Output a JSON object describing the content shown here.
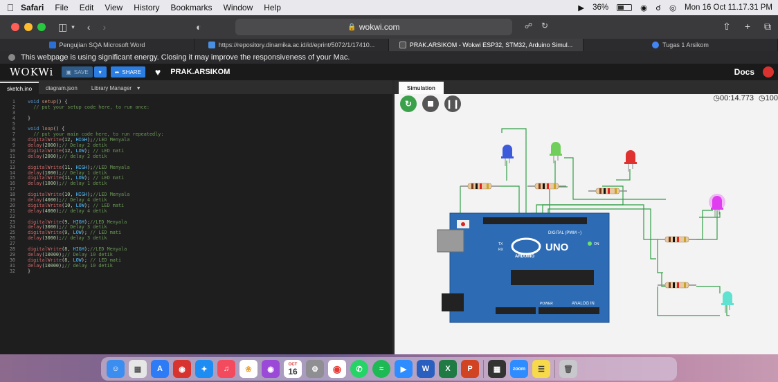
{
  "menubar": {
    "items": [
      "Safari",
      "File",
      "Edit",
      "View",
      "History",
      "Bookmarks",
      "Window",
      "Help"
    ],
    "battery": "36%",
    "clock": "Mon 16 Oct 11.17.31 PM"
  },
  "toolbar": {
    "url": "wokwi.com"
  },
  "tabs": [
    {
      "label": "Pengujian SQA Microsoft Word",
      "color": "#2b6fd6"
    },
    {
      "label": "https://repository.dinamika.ac.id/id/eprint/5072/1/17410...",
      "color": "#4a90e2"
    },
    {
      "label": "PRAK.ARSIKOM - Wokwi ESP32, STM32, Arduino Simul...",
      "color": "#333333"
    },
    {
      "label": "Tugas 1 Arsikom",
      "color": "#4285f4"
    }
  ],
  "banner": {
    "text": "This webpage is using significant energy. Closing it may improve the responsiveness of your Mac."
  },
  "wokwi": {
    "logo": "WOKWi",
    "save": "SAVE",
    "share": "SHARE",
    "project": "PRAK.ARSIKOM",
    "docs": "Docs"
  },
  "editor": {
    "tabs": [
      "sketch.ino",
      "diagram.json",
      "Library Manager"
    ],
    "lines": [
      "void setup() {",
      "  // put your setup code here, to run once:",
      "",
      "}",
      "",
      "void loop() {",
      "  // put your main code here, to run repeatedly:",
      "digitalWrite(12, HIGH);//LED Menyala",
      "delay(2000);// Delay 2 detik",
      "digitalWrite(12, LOW); // LED mati",
      "delay(2000);// delay 2 detik",
      "",
      "digitalWrite(11, HIGH);//LED Menyala",
      "delay(1000);// Delay 1 detik",
      "digitalWrite(11, LOW); // LED mati",
      "delay(1000);// delay 1 detik",
      "",
      "digitalWrite(10, HIGH);//LED Menyala",
      "delay(4000);// Delay 4 detik",
      "digitalWrite(10, LOW); // LED mati",
      "delay(4000);// delay 4 detik",
      "",
      "digitalWrite(9, HIGH);//LED Menyala",
      "delay(3000);// Delay 3 detik",
      "digitalWrite(9, LOW); // LED mati",
      "delay(3000);// delay 3 detik",
      "",
      "digitalWrite(8, HIGH);//LED Menyala",
      "delay(10000);// Delay 10 detik",
      "digitalWrite(8, LOW); // LED mati",
      "delay(10000);// delay 10 detik",
      "}"
    ]
  },
  "simulation": {
    "tab": "Simulation",
    "timer": "00:14.773",
    "speed": "100",
    "board": {
      "logo_text": "ARDUINO",
      "model": "UNO",
      "on_label": "ON",
      "digital_label": "DIGITAL (PWM ~)",
      "analog_label": "ANALOG IN",
      "power_label": "POWER",
      "tx": "TX",
      "rx": "RX"
    }
  },
  "dock": {
    "calendar_month": "OCT",
    "calendar_day": "16",
    "apps": [
      "finder-icon",
      "launchpad-icon",
      "app-store-icon",
      "photo-booth-icon",
      "safari-icon",
      "music-icon",
      "photos-icon",
      "podcasts-icon",
      "calendar-icon",
      "system-preferences-icon",
      "chrome-icon",
      "whatsapp-icon",
      "spotify-icon",
      "zoom-icon",
      "word-icon",
      "excel-icon",
      "powerpoint-icon",
      "calculator-icon",
      "zoom-meeting-icon",
      "notes-icon",
      "trash-icon"
    ],
    "zoom_label": "zoom"
  }
}
